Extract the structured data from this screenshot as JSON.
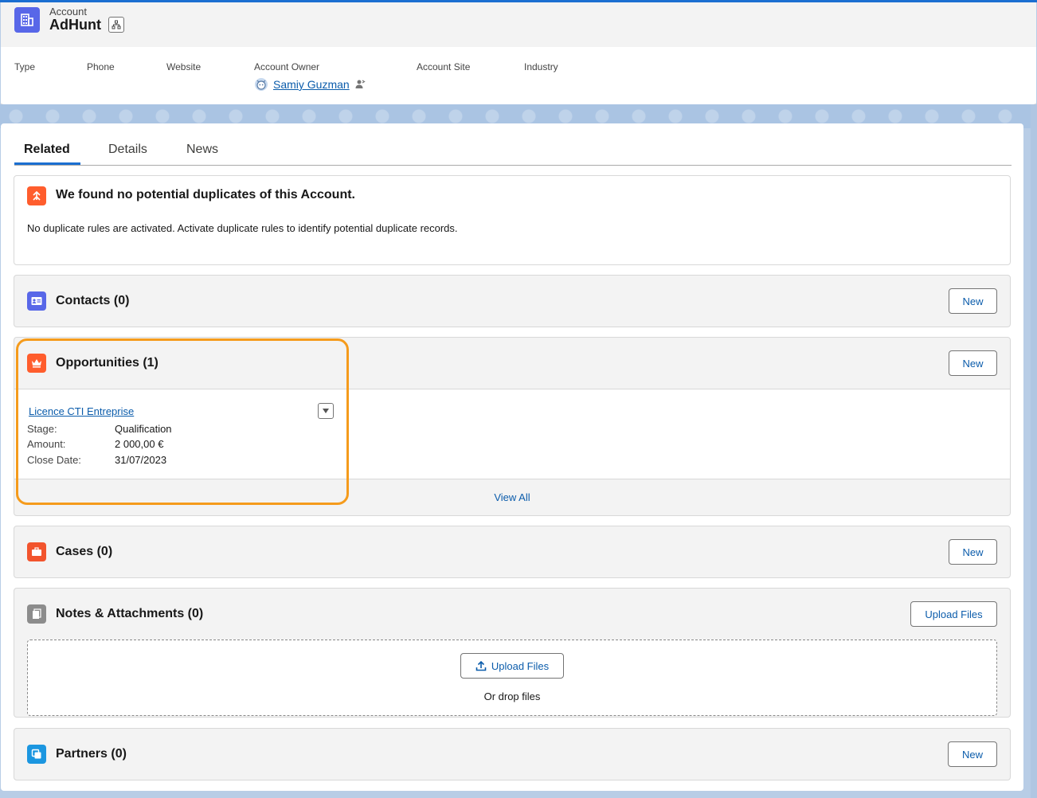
{
  "header": {
    "object_label": "Account",
    "record_name": "AdHunt",
    "fields": [
      {
        "label": "Type"
      },
      {
        "label": "Phone"
      },
      {
        "label": "Website"
      },
      {
        "label": "Account Owner",
        "value": "Samiy Guzman"
      },
      {
        "label": "Account Site"
      },
      {
        "label": "Industry"
      }
    ]
  },
  "tabs": [
    "Related",
    "Details",
    "News"
  ],
  "active_tab": "Related",
  "duplicates": {
    "title": "We found no potential duplicates of this Account.",
    "message": "No duplicate rules are activated. Activate duplicate rules to identify potential duplicate records."
  },
  "contacts": {
    "title": "Contacts (0)",
    "button": "New"
  },
  "opportunities": {
    "title": "Opportunities (1)",
    "button": "New",
    "record": {
      "name": "Licence CTI Entreprise",
      "fields": [
        {
          "label": "Stage:",
          "value": "Qualification"
        },
        {
          "label": "Amount:",
          "value": "2 000,00 €"
        },
        {
          "label": "Close Date:",
          "value": "31/07/2023"
        }
      ]
    },
    "view_all": "View All"
  },
  "cases": {
    "title": "Cases (0)",
    "button": "New"
  },
  "notes": {
    "title": "Notes & Attachments (0)",
    "button": "Upload Files",
    "drop_button": "Upload Files",
    "drop_text": "Or drop files"
  },
  "partners": {
    "title": "Partners (0)",
    "button": "New"
  },
  "colors": {
    "brand_blue": "#1b6fd1",
    "link": "#0b5cab",
    "account_icon": "#5867e8",
    "opportunity_icon": "#ff5d2d",
    "case_icon": "#f2542d",
    "highlight": "#f59b1c"
  }
}
